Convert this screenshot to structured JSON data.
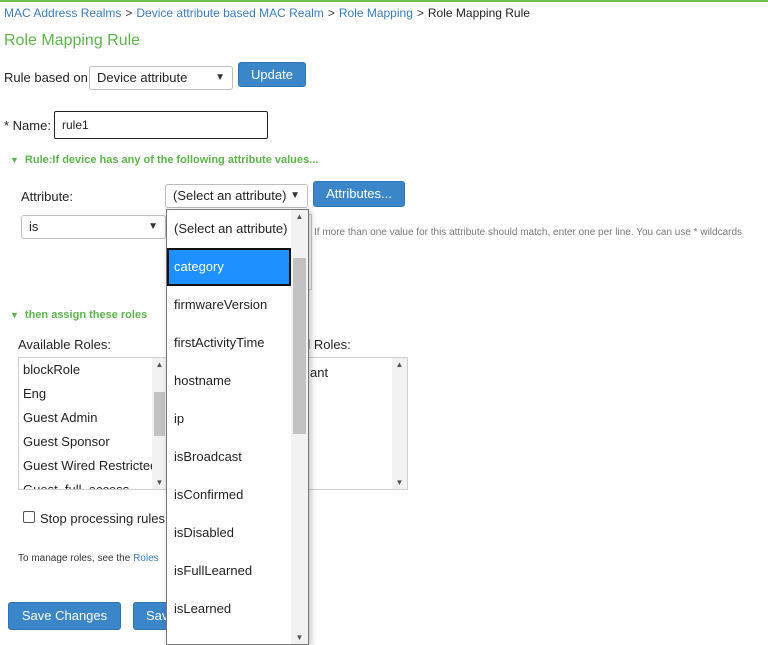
{
  "breadcrumb": {
    "items": [
      "MAC Address Realms",
      "Device attribute based MAC Realm",
      "Role Mapping"
    ],
    "separator": ">",
    "current": "Role Mapping Rule"
  },
  "page_title": "Role Mapping Rule",
  "rule_based_on": {
    "label": "Rule based on:",
    "value": "Device attribute",
    "update_label": "Update"
  },
  "name_field": {
    "label": "* Name:",
    "value": "rule1"
  },
  "rule_section": {
    "heading": "Rule:If device has any of the following attribute values...",
    "attribute_label": "Attribute:",
    "attribute_value": "(Select an attribute)",
    "attributes_button": "Attributes...",
    "operator_value": "is",
    "hint": "If more than one value for this attribute should match, enter one per line. You can use * wildcards"
  },
  "roles_section": {
    "heading": "then assign these roles",
    "available_label": "Available Roles:",
    "available_roles": [
      "blockRole",
      "Eng",
      "Guest Admin",
      "Guest Sponsor",
      "Guest Wired Restricted",
      "Guest_full_access"
    ],
    "selected_label_partial": "d Roles:",
    "selected_roles_partial": [
      "ant"
    ],
    "stop_processing_label": "Stop processing rules w",
    "manage_text": "To manage roles, see the",
    "manage_link": "Roles"
  },
  "dropdown": {
    "options": [
      "(Select an attribute)",
      "category",
      "firmwareVersion",
      "firstActivityTime",
      "hostname",
      "ip",
      "isBroadcast",
      "isConfirmed",
      "isDisabled",
      "isFullLearned",
      "isLearned"
    ],
    "highlighted_index": 1
  },
  "footer": {
    "save_changes": "Save Changes",
    "save_partial": "Sav"
  },
  "colors": {
    "accent_green": "#5cb54a",
    "button_blue": "#3b86c8",
    "link_blue": "#3a7bbf",
    "highlight_blue": "#1e90ff"
  }
}
